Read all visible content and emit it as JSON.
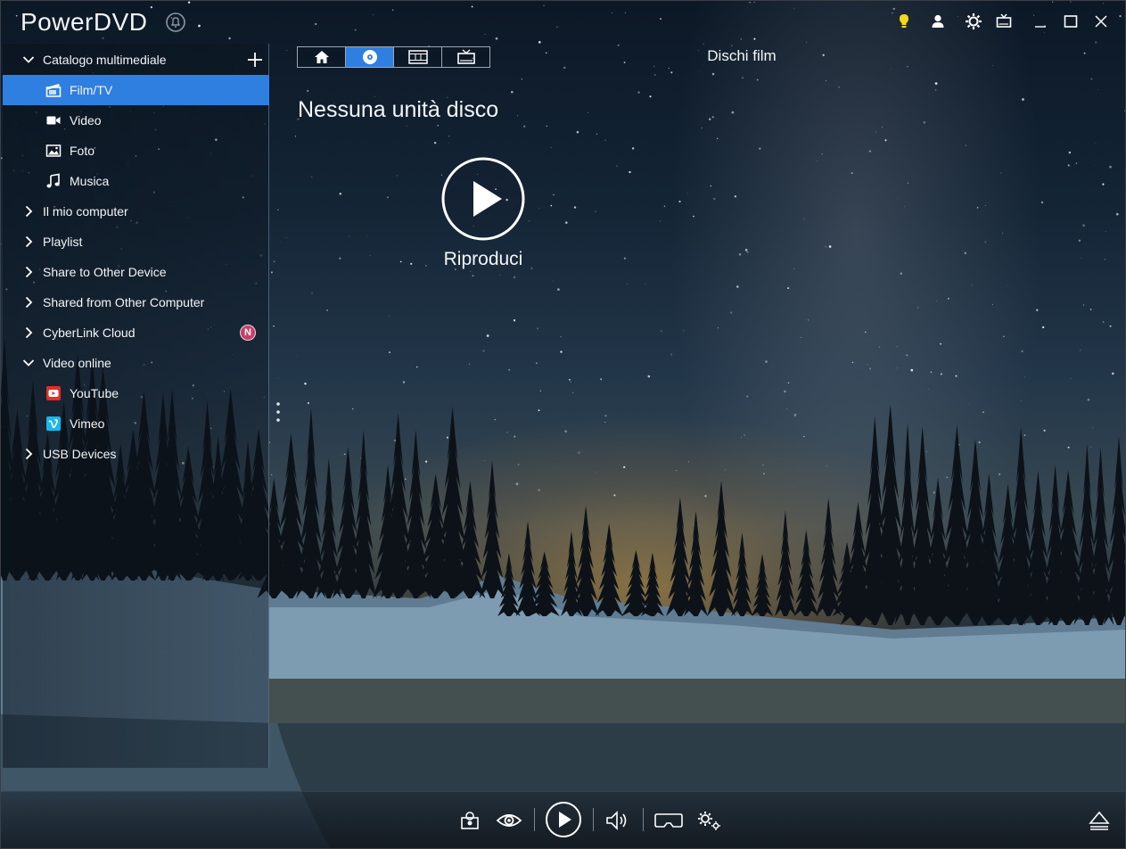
{
  "app": {
    "title": "PowerDVD"
  },
  "sidebar": {
    "sections": [
      {
        "label": "Catalogo multimediale",
        "expanded": true
      },
      {
        "label": "Il mio computer",
        "expanded": false
      },
      {
        "label": "Playlist",
        "expanded": false
      },
      {
        "label": "Share to Other Device",
        "expanded": false
      },
      {
        "label": "Shared from Other Computer",
        "expanded": false
      },
      {
        "label": "CyberLink Cloud",
        "expanded": false,
        "badge": "N"
      },
      {
        "label": "Video online",
        "expanded": true
      },
      {
        "label": "USB Devices",
        "expanded": false
      }
    ],
    "media_items": [
      {
        "label": "Film/TV",
        "icon": "film-icon",
        "selected": true
      },
      {
        "label": "Video",
        "icon": "video-camera-icon"
      },
      {
        "label": "Foto",
        "icon": "photo-icon"
      },
      {
        "label": "Musica",
        "icon": "music-note-icon"
      }
    ],
    "online_items": [
      {
        "label": "YouTube",
        "icon": "youtube-icon"
      },
      {
        "label": "Vimeo",
        "icon": "vimeo-icon"
      }
    ]
  },
  "main": {
    "section_title": "Dischi film",
    "no_disc_text": "Nessuna unità disco",
    "play_label": "Riproduci",
    "mode_tabs": [
      {
        "icon": "home-icon",
        "active": false
      },
      {
        "icon": "disc-icon",
        "active": true
      },
      {
        "icon": "film-strip-icon",
        "active": false
      },
      {
        "icon": "tv-icon",
        "active": false
      }
    ]
  },
  "title_bar": {
    "icons": [
      "lightbulb-icon",
      "user-icon",
      "settings-icon",
      "tv-mode-icon",
      "minimize-icon",
      "maximize-icon",
      "close-icon"
    ]
  },
  "player_bar": {
    "icons": [
      "snapshot-icon",
      "eye-icon",
      "play-icon",
      "volume-icon",
      "vr-headset-icon",
      "settings-gears-icon",
      "eject-icon"
    ]
  },
  "colors": {
    "accent": "#2f7fe0",
    "lightbulb": "#f5d81a",
    "badge": "#c4406a"
  }
}
